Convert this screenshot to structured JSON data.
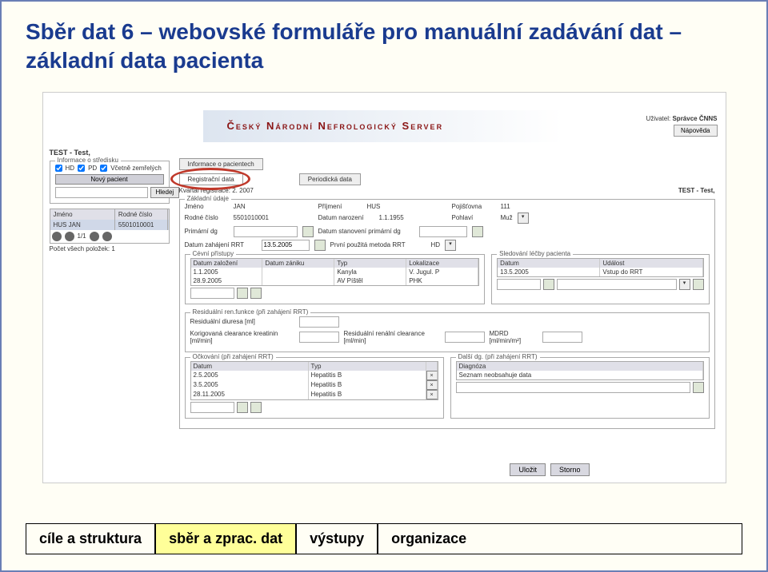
{
  "title": "Sběr dat 6 – webovské formuláře pro manuální zadávání dat – základní data pacienta",
  "banner": {
    "c": "Č",
    "rest1": "eský ",
    "n": "N",
    "rest2": "árodní ",
    "n2": "N",
    "rest3": "efrologický ",
    "s": "S",
    "rest4": "erver"
  },
  "user_label": "Uživatel:",
  "user_name": "Správce ČNNS",
  "help": "Nápověda",
  "test": "TEST - Test,",
  "sidebar": {
    "info_legend": "Informace o středisku",
    "hd": "HD",
    "pd": "PD",
    "zem": "Včetně zemřelých",
    "new_patient": "Nový pacient",
    "search": "Hledej",
    "col_jmeno": "Jméno",
    "col_rc": "Rodné číslo",
    "row_name": "HUS JAN",
    "row_rc": "5501010001",
    "page": "1/1",
    "count_label": "Počet všech položek:",
    "count": "1"
  },
  "tabs": {
    "info": "Informace o pacientech",
    "reg": "Registrační data",
    "per": "Periodická data"
  },
  "quarter": "Kvartál registrace: 2. 2007",
  "test_right": "TEST - Test,",
  "basic": {
    "legend": "Základní údaje",
    "jmeno_l": "Jméno",
    "jmeno": "JAN",
    "prijmeni_l": "Příjmení",
    "prijmeni": "HUS",
    "pojist_l": "Pojišťovna",
    "pojist": "111",
    "rc_l": "Rodné číslo",
    "rc": "5501010001",
    "narozeni_l": "Datum narození",
    "narozeni": "1.1.1955",
    "pohlavi_l": "Pohlaví",
    "pohlavi": "Muž",
    "primdg_l": "Primární dg",
    "stanov_l": "Datum stanovení primární dg",
    "zahaj_l": "Datum zahájení RRT",
    "zahaj": "13.5.2005",
    "prvni_l": "První použitá metoda RRT",
    "prvni": "HD"
  },
  "cevni": {
    "legend": "Cévní přístupy",
    "h1": "Datum založení",
    "h2": "Datum zániku",
    "h3": "Typ",
    "h4": "Lokalizace",
    "r1c1": "1.1.2005",
    "r1c3": "Kanyla",
    "r1c4": "V. Jugul. P",
    "r2c1": "28.9.2005",
    "r2c3": "AV Píštěl",
    "r2c4": "PHK"
  },
  "sledovani": {
    "legend": "Sledování léčby pacienta",
    "h1": "Datum",
    "h2": "Událost",
    "r1c1": "13.5.2005",
    "r1c2": "Vstup do RRT"
  },
  "residual": {
    "legend": "Residuální ren.funkce (při zahájení RRT)",
    "l1": "Residuální diuresa [ml]",
    "l2": "Korigovaná clearance kreatinin [ml/min]",
    "l3": "Residuální renální clearance [ml/min]",
    "l4": "MDRD [ml/min/m²]"
  },
  "ockovani": {
    "legend": "Očkování (při zahájení RRT)",
    "h1": "Datum",
    "h2": "Typ",
    "r1c1": "2.5.2005",
    "r1c2": "Hepatitis B",
    "r2c1": "3.5.2005",
    "r2c2": "Hepatitis B",
    "r3c1": "28.11.2005",
    "r3c2": "Hepatitis B"
  },
  "dalsi": {
    "legend": "Další dg. (při zahájení RRT)",
    "h1": "Diagnóza",
    "empty": "Seznam neobsahuje data"
  },
  "save": "Uložit",
  "cancel": "Storno",
  "footer": {
    "t1": "cíle a struktura",
    "t2": "sběr a zprac. dat",
    "t3": "výstupy",
    "t4": "organizace"
  }
}
